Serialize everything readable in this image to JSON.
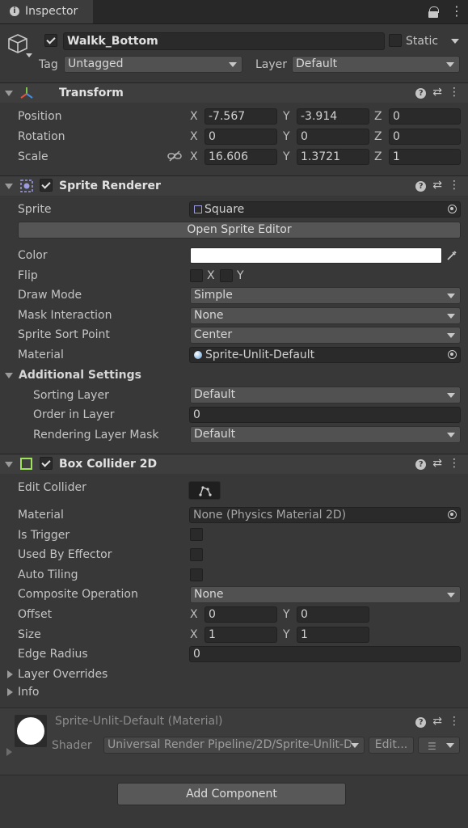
{
  "tab": {
    "title": "Inspector"
  },
  "object": {
    "name": "Walkk_Bottom",
    "static_label": "Static",
    "tag_label": "Tag",
    "tag_value": "Untagged",
    "layer_label": "Layer",
    "layer_value": "Default"
  },
  "transform": {
    "title": "Transform",
    "rows": [
      {
        "label": "Position",
        "x": "-7.567",
        "y": "-3.914",
        "z": "0"
      },
      {
        "label": "Rotation",
        "x": "0",
        "y": "0",
        "z": "0"
      },
      {
        "label": "Scale",
        "x": "16.606",
        "y": "1.3721",
        "z": "1"
      }
    ],
    "axes": {
      "x": "X",
      "y": "Y",
      "z": "Z"
    }
  },
  "sprite_renderer": {
    "title": "Sprite Renderer",
    "sprite_label": "Sprite",
    "sprite_value": "Square",
    "open_editor": "Open Sprite Editor",
    "color_label": "Color",
    "color_value": "#ffffff",
    "flip_label": "Flip",
    "flip_x": "X",
    "flip_y": "Y",
    "draw_mode_label": "Draw Mode",
    "draw_mode_value": "Simple",
    "mask_label": "Mask Interaction",
    "mask_value": "None",
    "sort_point_label": "Sprite Sort Point",
    "sort_point_value": "Center",
    "material_label": "Material",
    "material_value": "Sprite-Unlit-Default",
    "additional_label": "Additional Settings",
    "sorting_layer_label": "Sorting Layer",
    "sorting_layer_value": "Default",
    "order_label": "Order in Layer",
    "order_value": "0",
    "rendering_mask_label": "Rendering Layer Mask",
    "rendering_mask_value": "Default"
  },
  "box_collider": {
    "title": "Box Collider 2D",
    "edit_label": "Edit Collider",
    "material_label": "Material",
    "material_value": "None (Physics Material 2D)",
    "trigger_label": "Is Trigger",
    "effector_label": "Used By Effector",
    "tiling_label": "Auto Tiling",
    "composite_label": "Composite Operation",
    "composite_value": "None",
    "offset_label": "Offset",
    "offset_x": "0",
    "offset_y": "0",
    "size_label": "Size",
    "size_x": "1",
    "size_y": "1",
    "edge_label": "Edge Radius",
    "edge_value": "0",
    "layer_overrides": "Layer Overrides",
    "info": "Info"
  },
  "material_panel": {
    "title": "Sprite-Unlit-Default (Material)",
    "shader_label": "Shader",
    "shader_value": "Universal Render Pipeline/2D/Sprite-Unlit-D",
    "edit_label": "Edit..."
  },
  "add_component": "Add Component"
}
